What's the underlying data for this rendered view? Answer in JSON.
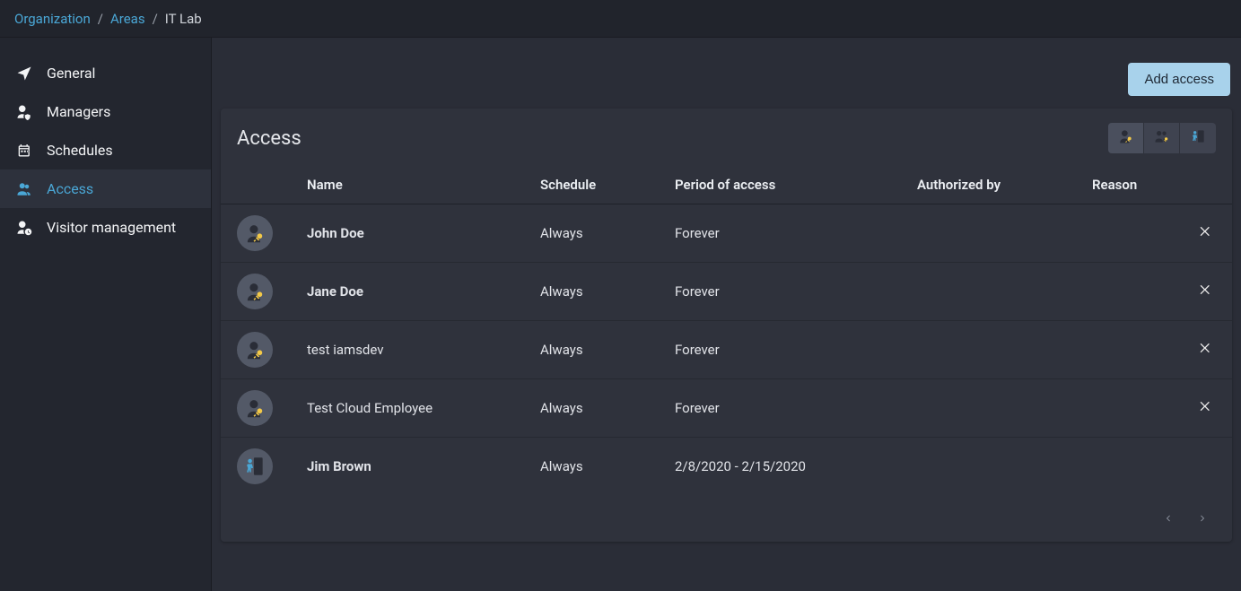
{
  "breadcrumb": {
    "org": "Organization",
    "areas": "Areas",
    "current": "IT Lab"
  },
  "sidebar": {
    "items": [
      {
        "label": "General"
      },
      {
        "label": "Managers"
      },
      {
        "label": "Schedules"
      },
      {
        "label": "Access"
      },
      {
        "label": "Visitor management"
      }
    ]
  },
  "actions": {
    "add_access": "Add access"
  },
  "panel": {
    "title": "Access"
  },
  "table": {
    "headers": {
      "name": "Name",
      "schedule": "Schedule",
      "period": "Period of access",
      "authorized_by": "Authorized by",
      "reason": "Reason"
    },
    "rows": [
      {
        "name": "John Doe",
        "bold": true,
        "schedule": "Always",
        "period": "Forever",
        "authorized_by": "",
        "reason": "",
        "icon": "person-key",
        "removable": true
      },
      {
        "name": "Jane Doe",
        "bold": true,
        "schedule": "Always",
        "period": "Forever",
        "authorized_by": "",
        "reason": "",
        "icon": "person-key",
        "removable": true
      },
      {
        "name": "test iamsdev",
        "bold": false,
        "schedule": "Always",
        "period": "Forever",
        "authorized_by": "",
        "reason": "",
        "icon": "person-key",
        "removable": true
      },
      {
        "name": "Test Cloud Employee",
        "bold": false,
        "schedule": "Always",
        "period": "Forever",
        "authorized_by": "",
        "reason": "",
        "icon": "person-key",
        "removable": true
      },
      {
        "name": "Jim Brown",
        "bold": true,
        "schedule": "Always",
        "period": "2/8/2020 - 2/15/2020",
        "authorized_by": "",
        "reason": "",
        "icon": "door-person",
        "removable": false
      }
    ]
  }
}
